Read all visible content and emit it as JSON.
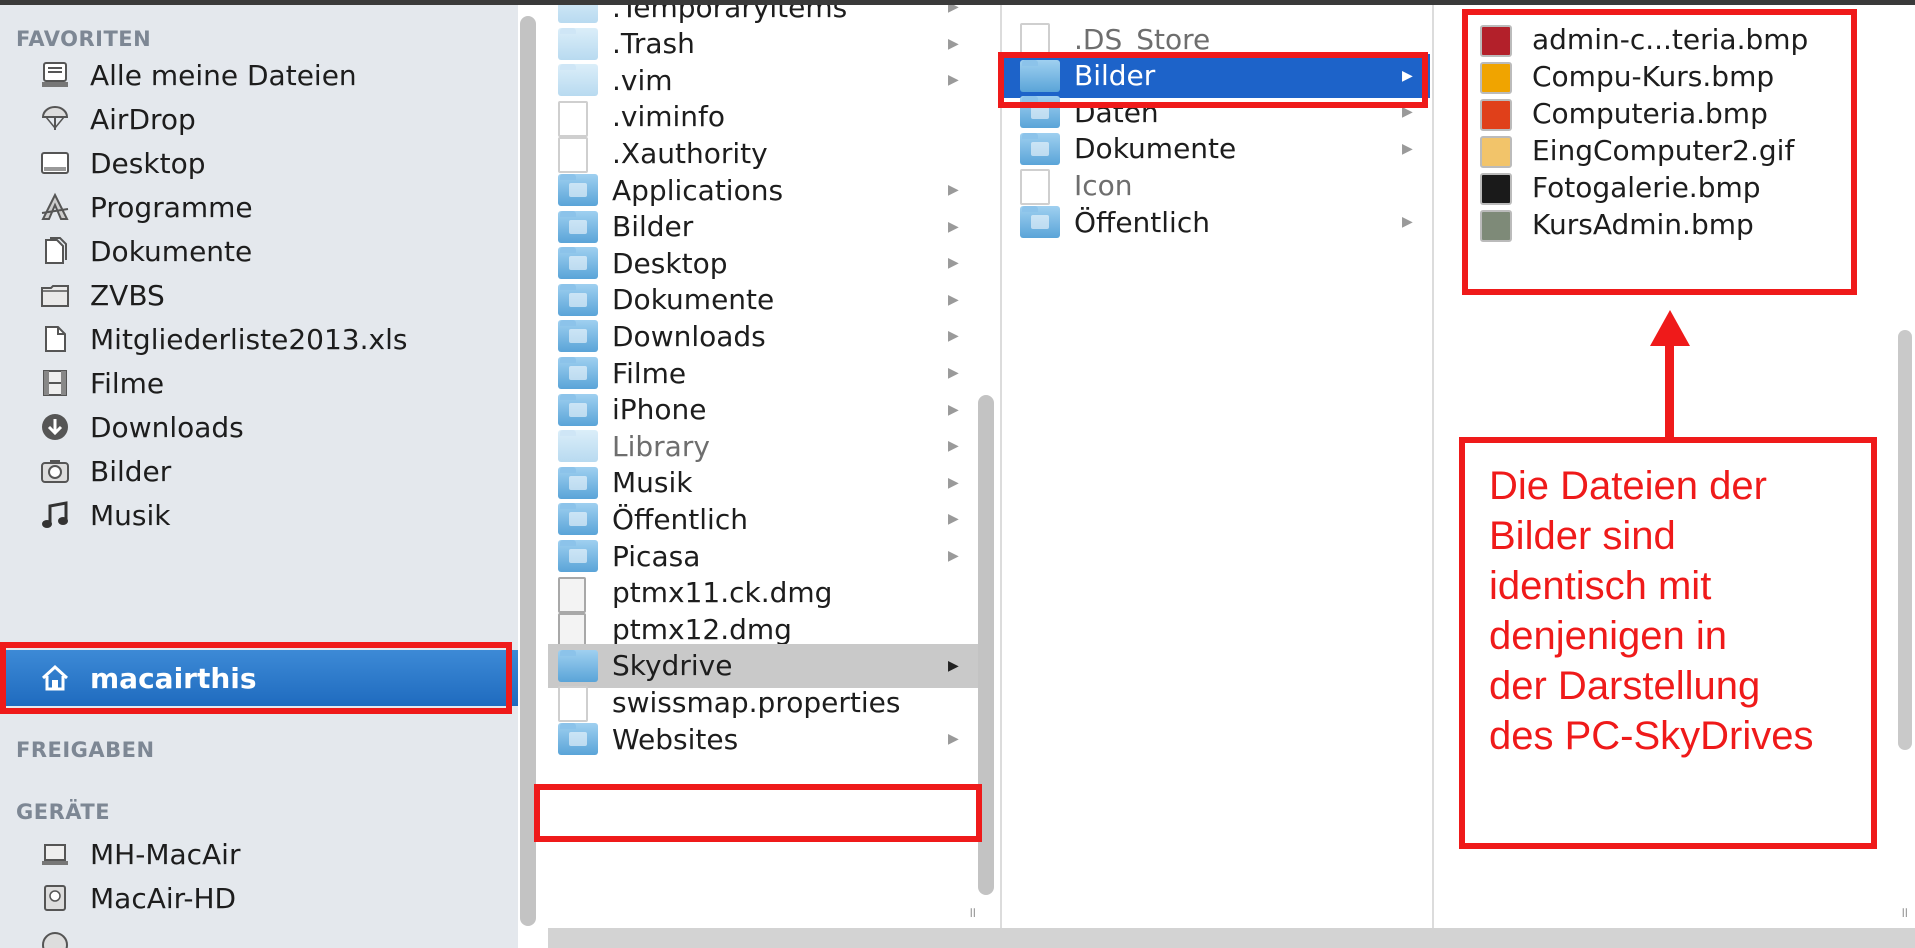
{
  "sidebar": {
    "sections": {
      "favorites": "FAVORITEN",
      "shares": "FREIGABEN",
      "devices": "GERÄTE"
    },
    "favorites": [
      {
        "label": "Alle meine Dateien",
        "icon": "all-files-icon"
      },
      {
        "label": "AirDrop",
        "icon": "airdrop-icon"
      },
      {
        "label": "Desktop",
        "icon": "desktop-icon"
      },
      {
        "label": "Programme",
        "icon": "applications-icon"
      },
      {
        "label": "Dokumente",
        "icon": "documents-icon"
      },
      {
        "label": "ZVBS",
        "icon": "folder-icon"
      },
      {
        "label": "Mitgliederliste2013.xls",
        "icon": "document-icon"
      },
      {
        "label": "Filme",
        "icon": "movies-icon"
      },
      {
        "label": "Downloads",
        "icon": "downloads-icon"
      },
      {
        "label": "Bilder",
        "icon": "camera-icon"
      },
      {
        "label": "Musik",
        "icon": "music-icon"
      },
      {
        "label": "macairthis",
        "icon": "home-icon",
        "selected": true
      }
    ],
    "devices": [
      {
        "label": "MH-MacAir",
        "icon": "laptop-icon"
      },
      {
        "label": "MacAir-HD",
        "icon": "harddisk-icon"
      }
    ]
  },
  "column1": {
    "items": [
      {
        "name": ".Temporaryitems",
        "type": "folder-light",
        "arrow": true
      },
      {
        "name": ".Trash",
        "type": "folder-light",
        "arrow": true
      },
      {
        "name": ".vim",
        "type": "folder-light",
        "arrow": true
      },
      {
        "name": ".viminfo",
        "type": "doc"
      },
      {
        "name": ".Xauthority",
        "type": "doc"
      },
      {
        "name": "Applications",
        "type": "folder",
        "arrow": true
      },
      {
        "name": "Bilder",
        "type": "folder",
        "arrow": true
      },
      {
        "name": "Desktop",
        "type": "folder",
        "arrow": true
      },
      {
        "name": "Dokumente",
        "type": "folder",
        "arrow": true
      },
      {
        "name": "Downloads",
        "type": "folder",
        "arrow": true
      },
      {
        "name": "Filme",
        "type": "folder",
        "arrow": true
      },
      {
        "name": "iPhone",
        "type": "folder",
        "arrow": true
      },
      {
        "name": "Library",
        "type": "folder-light",
        "arrow": true,
        "dim": true
      },
      {
        "name": "Musik",
        "type": "folder",
        "arrow": true
      },
      {
        "name": "Öffentlich",
        "type": "folder",
        "arrow": true
      },
      {
        "name": "Picasa",
        "type": "folder",
        "arrow": true
      },
      {
        "name": "ptmx11.ck.dmg",
        "type": "dmg"
      },
      {
        "name": "ptmx12.dmg",
        "type": "dmg"
      },
      {
        "name": "Skydrive",
        "type": "folder",
        "arrow": true,
        "selected": true
      },
      {
        "name": "swissmap.properties",
        "type": "doc"
      },
      {
        "name": "Websites",
        "type": "folder",
        "arrow": true
      }
    ]
  },
  "column2": {
    "items": [
      {
        "name": ".DS_Store",
        "type": "doc",
        "dim": true
      },
      {
        "name": "Bilder",
        "type": "folder",
        "arrow": true,
        "selected": true
      },
      {
        "name": "Daten",
        "type": "folder",
        "arrow": true
      },
      {
        "name": "Dokumente",
        "type": "folder",
        "arrow": true
      },
      {
        "name": "Icon",
        "type": "doc",
        "dim": true
      },
      {
        "name": "Öffentlich",
        "type": "folder",
        "arrow": true
      }
    ]
  },
  "column3": {
    "items": [
      {
        "name": "admin-c...teria.bmp",
        "icon": "bmp-thumbnail-icon",
        "color": "#b3202a"
      },
      {
        "name": "Compu-Kurs.bmp",
        "icon": "bmp-thumbnail-icon",
        "color": "#f0a400"
      },
      {
        "name": "Computeria.bmp",
        "icon": "bmp-thumbnail-icon",
        "color": "#e0401a"
      },
      {
        "name": "EingComputer2.gif",
        "icon": "gif-thumbnail-icon",
        "color": "#f2c46a"
      },
      {
        "name": "Fotogalerie.bmp",
        "icon": "bmp-thumbnail-icon",
        "color": "#1a1a1a"
      },
      {
        "name": "KursAdmin.bmp",
        "icon": "bmp-thumbnail-icon",
        "color": "#7e8a78"
      }
    ]
  },
  "annotation": {
    "lines": [
      "Die Dateien der",
      "Bilder sind",
      "identisch mit",
      "denjenigen in",
      "der Darstellung",
      "des PC-SkyDrives"
    ],
    "color": "#ef1a1a"
  },
  "colors": {
    "selection_blue": "#1d63c9",
    "sidebar_bg": "#e4e8ed",
    "highlight_red": "#ef1a1a"
  }
}
